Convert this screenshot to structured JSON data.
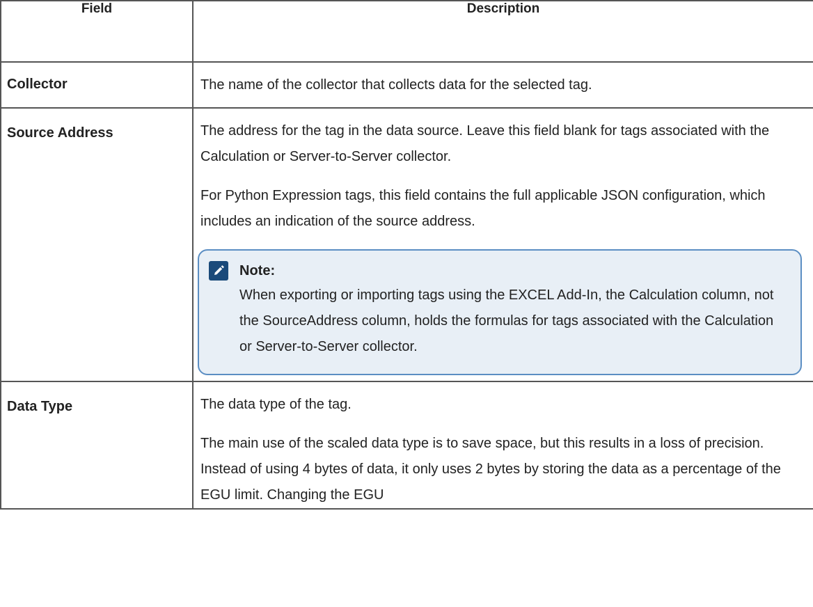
{
  "table": {
    "headers": {
      "field": "Field",
      "description": "Description"
    },
    "collector": {
      "field": "Collector",
      "desc": "The name of the collector that collects data for the selected tag."
    },
    "source_address": {
      "field": "Source Address",
      "desc1": "The address for the tag in the data source. Leave this field blank for tags associated with the Calculation or Server-to-Server collector.",
      "desc2": "For Python Expression tags, this field contains the full applicable JSON configuration, which includes an indication of the source address.",
      "note_title": "Note:",
      "note_icon": "pencil-note-icon",
      "note_body": "When exporting or importing tags using the EXCEL Add-In, the Calculation column, not the SourceAddress column, holds the formulas for tags associated with the Calculation or Server-to-Server collector."
    },
    "data_type": {
      "field": "Data Type",
      "desc1": "The data type of the tag.",
      "desc2": "The main use of the scaled data type is to save space, but this results in a loss of precision. Instead of using 4 bytes of data, it only uses 2 bytes by storing the data as a percentage of the EGU limit. Changing the EGU"
    }
  },
  "colors": {
    "border": "#555555",
    "note_border": "#5b8ec3",
    "note_bg": "#e8eff6",
    "note_icon_bg": "#1a4a7a"
  }
}
